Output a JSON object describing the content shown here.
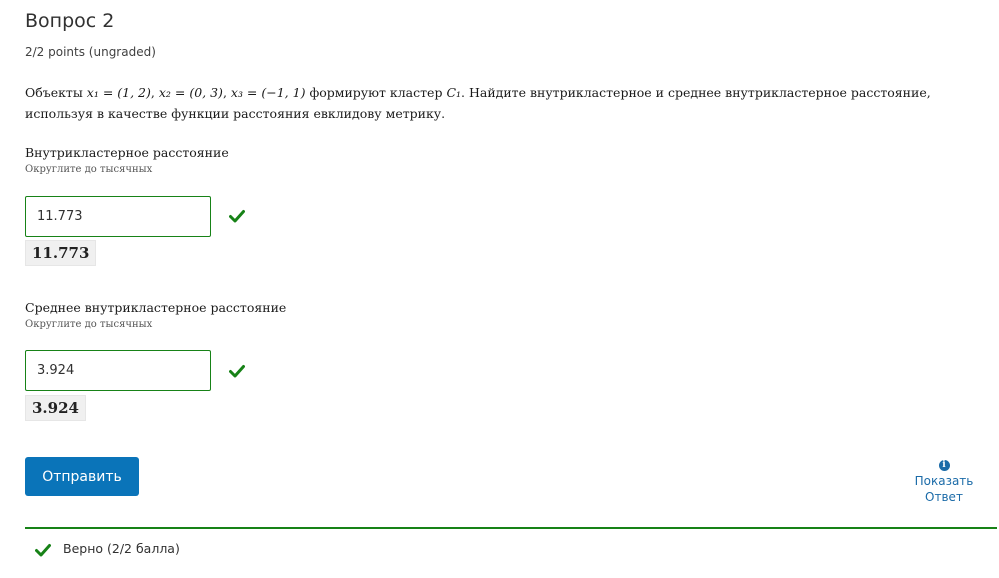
{
  "header": {
    "title": "Вопрос 2",
    "points": "2/2 points (ungraded)"
  },
  "question": {
    "prefix": "Объекты",
    "x1": "x₁ = (1, 2)",
    "x2": "x₂ = (0, 3)",
    "x3": "x₃ = (−1, 1)",
    "mid": "формируют кластер",
    "cluster": "C₁",
    "suffix": ". Найдите внутрикластерное и среднее внутрикластерное расстояние, используя в качестве функции расстояния евклидову метрику."
  },
  "answers": [
    {
      "label": "Внутрикластерное расстояние",
      "hint": "Округлите до тысячных",
      "value": "11.773",
      "preview": "11.773",
      "status_icon": "check-icon"
    },
    {
      "label": "Среднее внутрикластерное расстояние",
      "hint": "Округлите до тысячных",
      "value": "3.924",
      "preview": "3.924",
      "status_icon": "check-icon"
    }
  ],
  "actions": {
    "submit_label": "Отправить",
    "show_answer_line1": "Показать",
    "show_answer_line2": "Ответ",
    "show_answer_icon": "info-icon"
  },
  "feedback": {
    "text": "Верно (2/2 балла)",
    "icon": "check-icon"
  },
  "colors": {
    "correct": "#178217",
    "primary": "#0a74b9",
    "link": "#1b6ba8"
  }
}
